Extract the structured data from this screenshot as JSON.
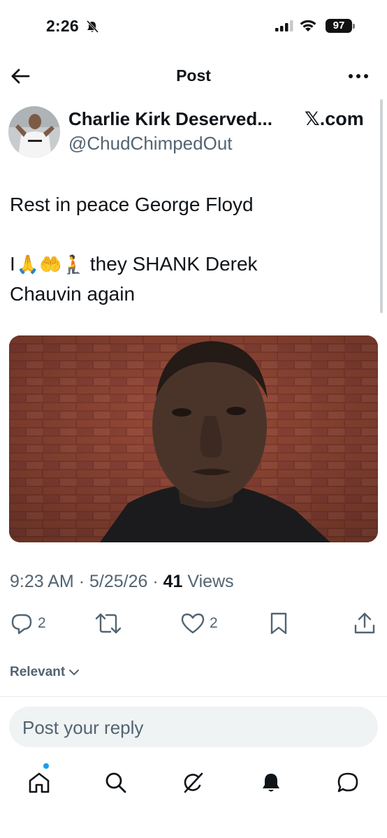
{
  "status_bar": {
    "time": "2:26",
    "battery": "97"
  },
  "header": {
    "title": "Post"
  },
  "author": {
    "name": "Charlie Kirk Deserved...",
    "handle": "@ChudChimpedOut",
    "source": "𝕏.com"
  },
  "tweet": {
    "line1": "Rest in peace George Floyd",
    "line2_prefix": "I",
    "emojis": "🙏🤲🧎",
    "line2_suffix": "they SHANK Derek",
    "line3": "Chauvin again"
  },
  "meta": {
    "time": "9:23 AM",
    "date": "5/25/26",
    "views_count": "41",
    "views_label": "Views"
  },
  "actions": {
    "replies": "2",
    "likes": "2"
  },
  "sort": {
    "label": "Relevant"
  },
  "reply": {
    "placeholder": "Post your reply"
  },
  "colors": {
    "accent": "#1d9bf0",
    "text": "#0f1419",
    "secondary": "#536471"
  },
  "icons": [
    "back-arrow-icon",
    "more-icon",
    "reply-icon",
    "repost-icon",
    "like-icon",
    "bookmark-icon",
    "share-icon",
    "home-icon",
    "search-icon",
    "grok-icon",
    "notifications-icon",
    "messages-icon"
  ]
}
